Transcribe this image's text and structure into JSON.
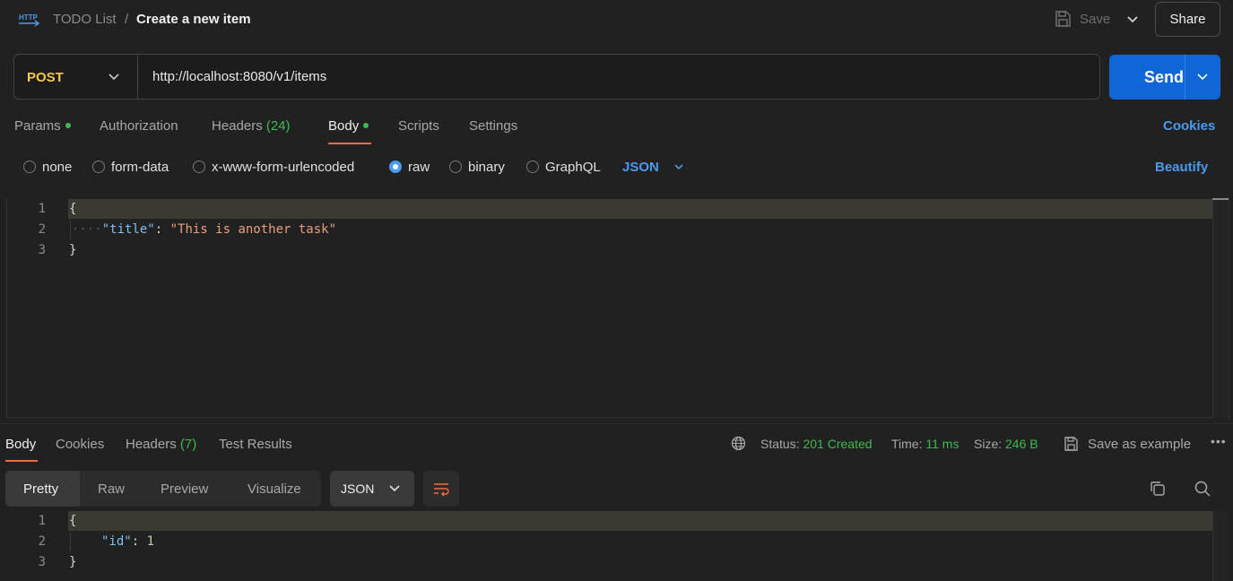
{
  "header": {
    "collection": "TODO List",
    "separator": "/",
    "title": "Create a new item",
    "save_label": "Save",
    "share_label": "Share"
  },
  "request": {
    "method": "POST",
    "url": "http://localhost:8080/v1/items",
    "send_label": "Send"
  },
  "tabs": {
    "params": "Params",
    "authorization": "Authorization",
    "headers": "Headers",
    "headers_count": "(24)",
    "body": "Body",
    "scripts": "Scripts",
    "settings": "Settings",
    "cookies": "Cookies"
  },
  "body_types": {
    "none": "none",
    "form_data": "form-data",
    "urlencoded": "x-www-form-urlencoded",
    "raw": "raw",
    "binary": "binary",
    "graphql": "GraphQL",
    "selected": "raw",
    "format": "JSON",
    "beautify": "Beautify"
  },
  "request_body": {
    "lines": [
      "1",
      "2",
      "3"
    ],
    "open": "{",
    "key": "\"title\"",
    "colon": ": ",
    "value": "\"This is another task\"",
    "close": "}",
    "indent": "····"
  },
  "response": {
    "tabs": {
      "body": "Body",
      "cookies": "Cookies",
      "headers": "Headers",
      "headers_count": "(7)",
      "test_results": "Test Results"
    },
    "status_label": "Status:",
    "status_value": "201 Created",
    "time_label": "Time:",
    "time_value": "11 ms",
    "size_label": "Size:",
    "size_value": "246 B",
    "save_example": "Save as example",
    "more": "•••",
    "views": {
      "pretty": "Pretty",
      "raw": "Raw",
      "preview": "Preview",
      "visualize": "Visualize"
    },
    "format": "JSON",
    "lines": [
      "1",
      "2",
      "3"
    ],
    "open": "{",
    "key": "\"id\"",
    "colon": ": ",
    "value": "1",
    "close": "}"
  },
  "colors": {
    "accent": "#0f66d6",
    "link": "#4a9aef",
    "method": "#f3c84b",
    "success": "#3fb950",
    "tab_underline": "#f26b3a"
  },
  "icons": [
    "http-icon",
    "save-icon",
    "chevron-down-icon",
    "globe-icon",
    "save-example-icon",
    "more-icon",
    "wrap-lines-icon",
    "copy-icon",
    "search-icon"
  ]
}
